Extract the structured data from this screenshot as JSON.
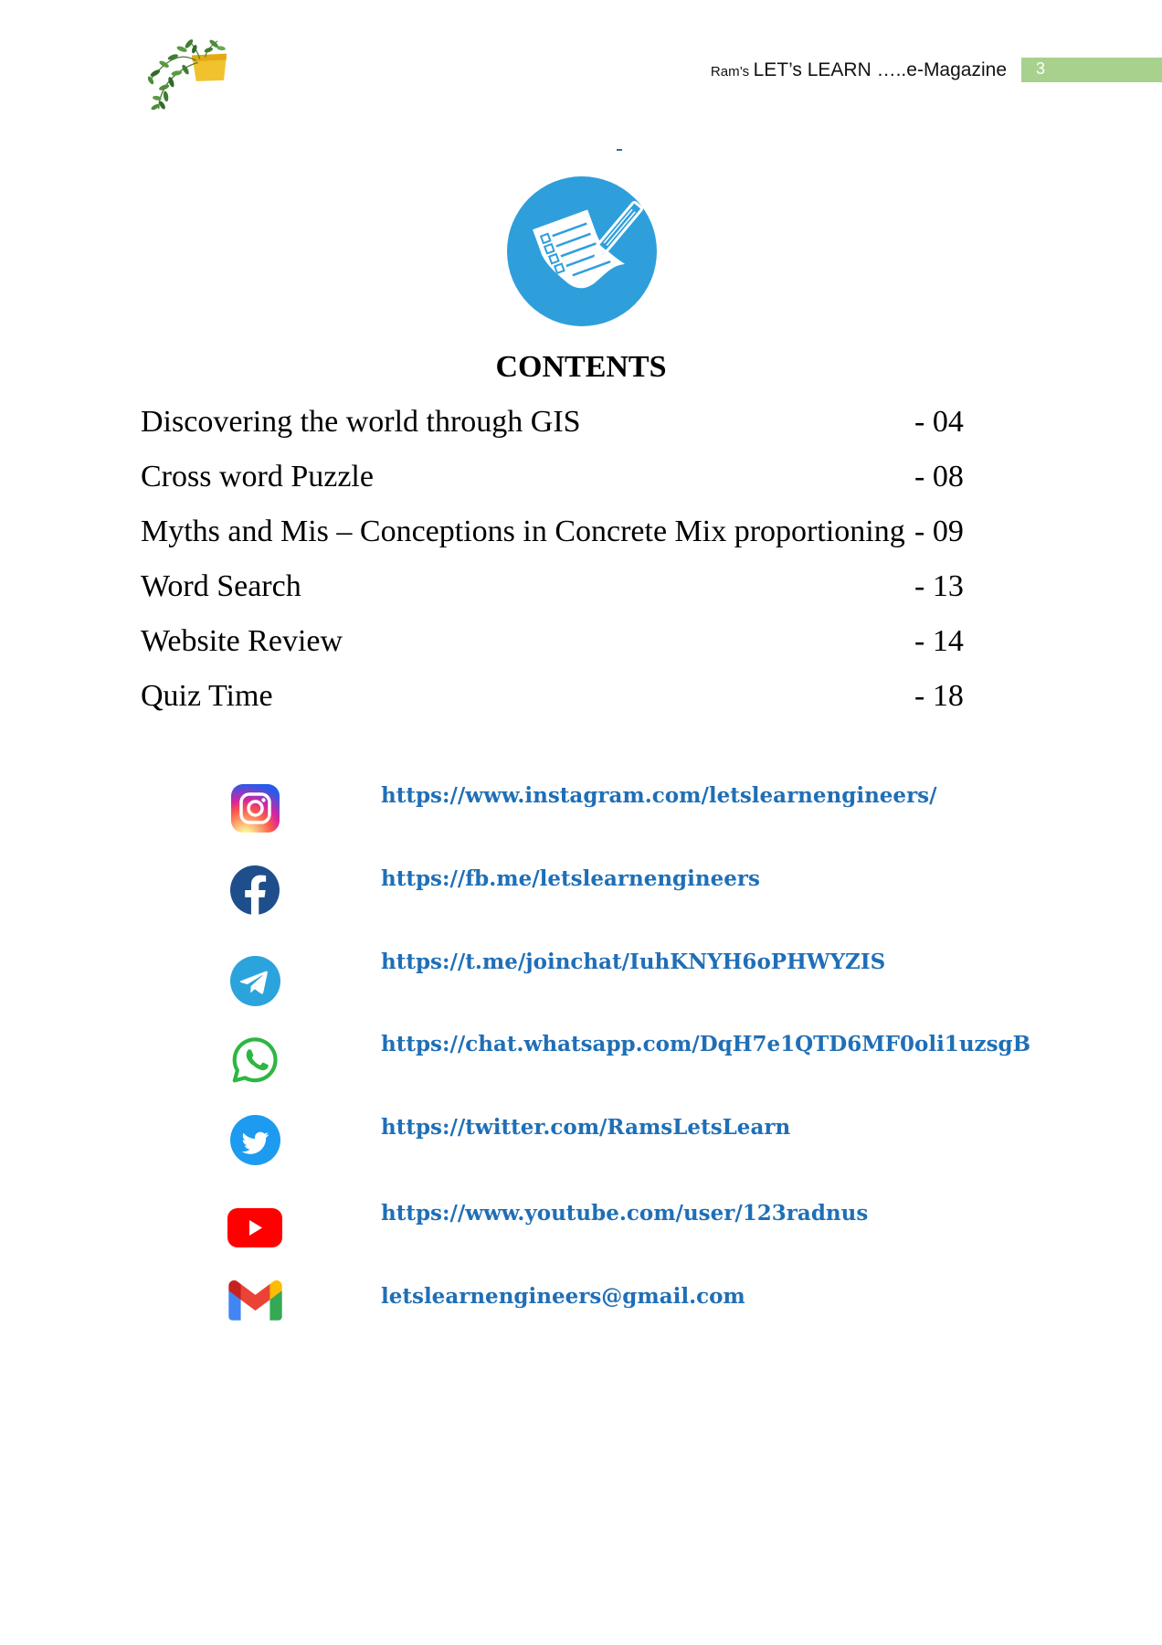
{
  "header": {
    "title_prefix": "Ram’s",
    "title": "LET’s LEARN …..e-Magazine",
    "page_number": "3"
  },
  "colors": {
    "page_tab": "#a9d18e",
    "link": "#1f6fb7",
    "contents_icon": "#2f9fdc"
  },
  "icons": {
    "logo": "potted-plant-logo",
    "contents": "checklist-document-pen-icon"
  },
  "contents": {
    "heading": "CONTENTS",
    "items": [
      {
        "title": "Discovering the world through GIS",
        "page": "- 04"
      },
      {
        "title": "Cross word Puzzle",
        "page": "- 08"
      },
      {
        "title": "Myths and Mis – Conceptions in Concrete Mix proportioning",
        "page": "- 09"
      },
      {
        "title": "Word Search",
        "page": "- 13"
      },
      {
        "title": "Website Review",
        "page": "- 14"
      },
      {
        "title": "Quiz Time",
        "page": "- 18"
      }
    ]
  },
  "social_links": [
    {
      "icon": "instagram-icon",
      "text": "https://www.instagram.com/letslearnengineers/"
    },
    {
      "icon": "facebook-icon",
      "text": "https://fb.me/letslearnengineers"
    },
    {
      "icon": "telegram-icon",
      "text": "https://t.me/joinchat/IuhKNYH6oPHWYZIS"
    },
    {
      "icon": "whatsapp-icon",
      "text": "https://chat.whatsapp.com/DqH7e1QTD6MF0oli1uzsgB"
    },
    {
      "icon": "twitter-icon",
      "text": "https://twitter.com/RamsLetsLearn"
    },
    {
      "icon": "youtube-icon",
      "text": "https://www.youtube.com/user/123radnus"
    },
    {
      "icon": "gmail-icon",
      "text": "letslearnengineers@gmail.com"
    }
  ]
}
